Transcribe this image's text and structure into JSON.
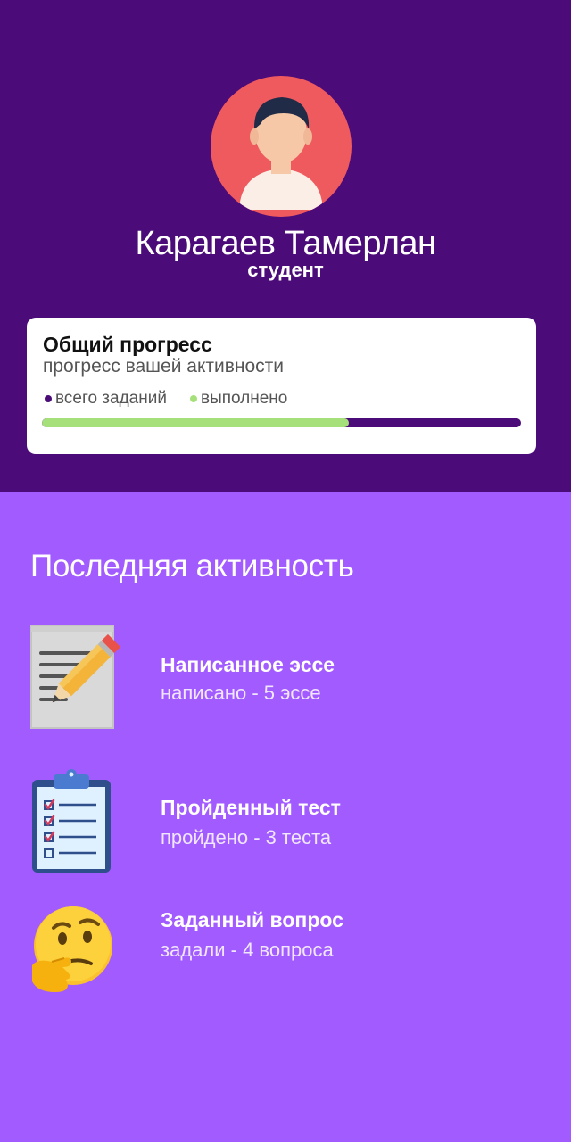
{
  "profile": {
    "name": "Карагаев Тамерлан",
    "role": "студент"
  },
  "progress": {
    "title": "Общий прогресс",
    "subtitle": "прогресс вашей активности",
    "legend_total": "всего заданий",
    "legend_done": "выполнено",
    "completed_fraction": 0.64,
    "colors": {
      "total": "#4b0b78",
      "done": "#a6e07a"
    }
  },
  "activity": {
    "section_title": "Последняя активность",
    "items": [
      {
        "icon": "essay-pencil-icon",
        "title": "Написанное эссе",
        "desc": "написано - 5 эссе"
      },
      {
        "icon": "clipboard-checklist-icon",
        "title": "Пройденный тест",
        "desc": "пройдено - 3 теста"
      },
      {
        "icon": "thinking-face-icon",
        "title": "Заданный вопрос",
        "desc": "задали - 4 вопроса"
      }
    ]
  },
  "colors": {
    "header_bg": "#4b0b78",
    "body_bg": "#a25bff",
    "avatar_bg": "#ef5a5f"
  }
}
